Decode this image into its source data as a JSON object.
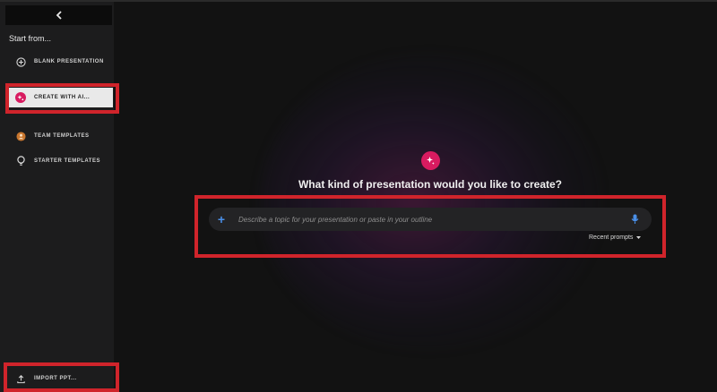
{
  "sidebar": {
    "start_label": "Start from...",
    "items": [
      {
        "label": "BLANK PRESENTATION",
        "icon": "plus-circle-icon"
      },
      {
        "label": "CREATE WITH AI...",
        "icon": "ai-sparkle-icon",
        "selected": true
      },
      {
        "label": "TEAM TEMPLATES",
        "icon": "team-icon"
      },
      {
        "label": "STARTER TEMPLATES",
        "icon": "lightbulb-icon"
      }
    ],
    "import_label": "IMPORT PPT..."
  },
  "main": {
    "heading": "What kind of presentation would you like to create?",
    "prompt_placeholder": "Describe a topic for your presentation or paste in your outline",
    "recent_prompts_label": "Recent prompts"
  },
  "colors": {
    "accent": "#d81b60",
    "highlight": "#d0242b",
    "plus": "#4a8fe8"
  }
}
